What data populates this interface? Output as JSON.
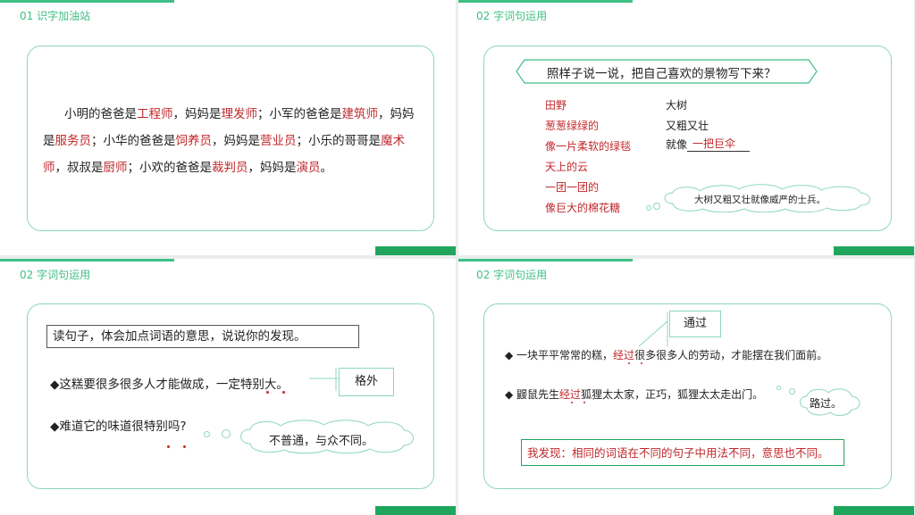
{
  "slide1": {
    "header": "01 识字加油站",
    "segments": [
      {
        "t": "小明的爸爸是",
        "r": false
      },
      {
        "t": "工程师",
        "r": true
      },
      {
        "t": "，妈妈是",
        "r": false
      },
      {
        "t": "理发师",
        "r": true
      },
      {
        "t": "；小军的爸爸是",
        "r": false
      },
      {
        "t": "建筑师",
        "r": true
      },
      {
        "t": "，妈妈是",
        "r": false
      },
      {
        "t": "服务员",
        "r": true
      },
      {
        "t": "；小华的爸爸是",
        "r": false
      },
      {
        "t": "饲养员",
        "r": true
      },
      {
        "t": "，妈妈是",
        "r": false
      },
      {
        "t": "营业员",
        "r": true
      },
      {
        "t": "；小乐的哥哥是",
        "r": false
      },
      {
        "t": "魔术师",
        "r": true
      },
      {
        "t": "，叔叔是",
        "r": false
      },
      {
        "t": "厨师",
        "r": true
      },
      {
        "t": "；小欢的爸爸是",
        "r": false
      },
      {
        "t": "裁判员",
        "r": true
      },
      {
        "t": "，妈妈是",
        "r": false
      },
      {
        "t": "演员",
        "r": true
      },
      {
        "t": "。",
        "r": false
      }
    ]
  },
  "slide2": {
    "header": "02 字词句运用",
    "banner": "照样子说一说，把自己喜欢的景物写下来？",
    "left_items": [
      "田野",
      "葱葱绿绿的",
      "像一片柔软的绿毯",
      "天上的云",
      "一团一团的",
      "像巨大的棉花糖"
    ],
    "right_items": [
      "大树",
      "又粗又壮"
    ],
    "right_prefix": "就像",
    "right_answer": "一把巨伞",
    "cloud_text": "大树又粗又壮就像威严的士兵。"
  },
  "slide3": {
    "header": "02 字词句运用",
    "instruction": "读句子，体会加点词语的意思，说说你的发现。",
    "sentence1": "◆这糕要很多很多人才能做成，一定特别大。",
    "box1": "格外",
    "sentence2": "◆难道它的味道很特别吗?",
    "cloud_text": "不普通，与众不同。"
  },
  "slide4": {
    "header": "02 字词句运用",
    "box1": "通过",
    "s1_a": "◆  一块平平常常的糕，",
    "s1_key": "经过",
    "s1_b": "很多很多人的劳动，才能摆在我们面前。",
    "s2_a": "◆  鼹鼠先生",
    "s2_key": "经过",
    "s2_b": "狐狸太太家，正巧，狐狸太太走出门。",
    "cloud_text": "路过。",
    "finding": "我发现：相同的词语在不同的句子中用法不同，意思也不同。"
  },
  "colors": {
    "accent": "#3fbf86",
    "dark_green": "#20a65c",
    "red": "#c0282c"
  }
}
